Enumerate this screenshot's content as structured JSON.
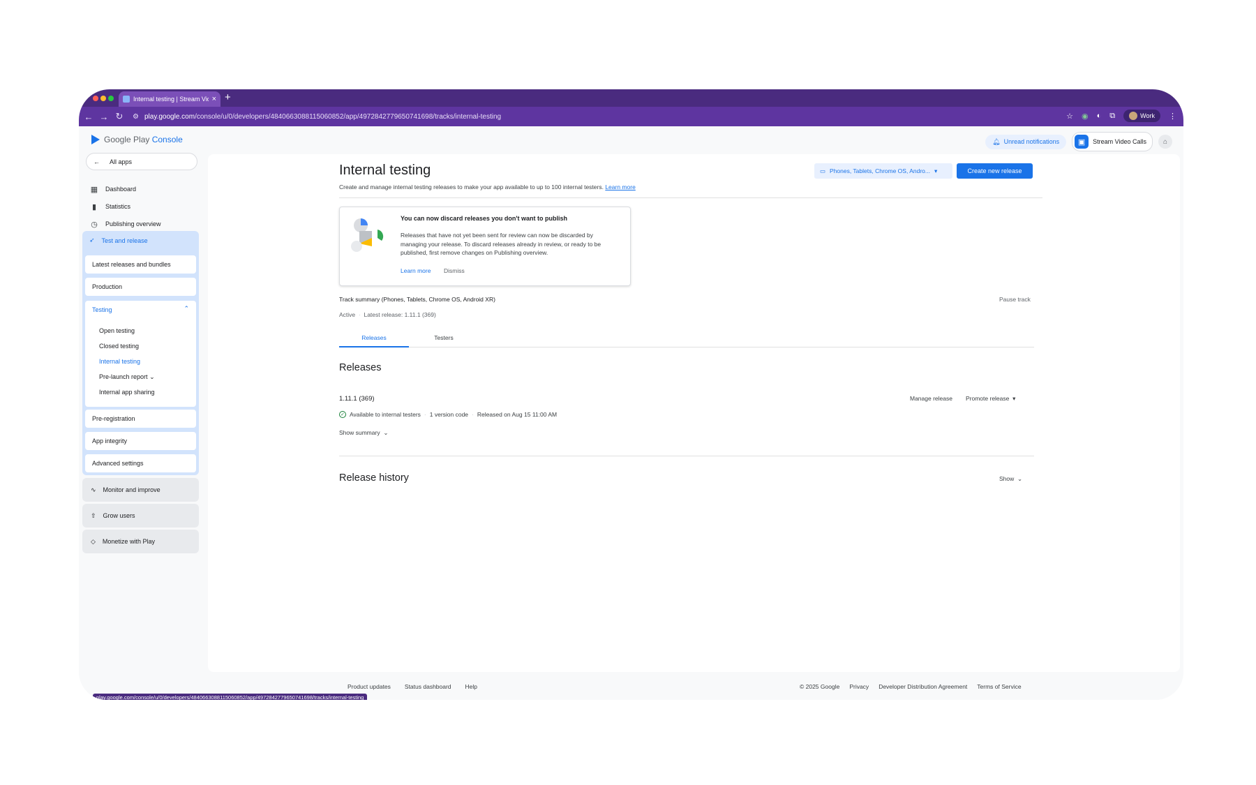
{
  "browser": {
    "tab_title": "Internal testing | Stream Vide…",
    "url_host": "play.google.com",
    "url_path": "/console/u/0/developers/4840663088115060852/app/4972842779650741698/tracks/internal-testing",
    "profile_label": "Work",
    "status_bar_url": "play.google.com/console/u/0/developers/4840663088115060852/app/4972842779650741698/tracks/internal-testing",
    "colors": {
      "tabbar": "#4a2b7f",
      "toolbar": "#5e35a0"
    }
  },
  "header": {
    "logo_text": "Google Play",
    "logo_console": "Console",
    "notifications_label": "Unread notifications",
    "app_name": "Stream Video Calls"
  },
  "sidebar": {
    "all_apps": "All apps",
    "top_items": [
      {
        "label": "Dashboard",
        "icon": "dashboard-icon"
      },
      {
        "label": "Statistics",
        "icon": "bar-chart-icon"
      },
      {
        "label": "Publishing overview",
        "icon": "publishing-icon"
      }
    ],
    "test_release": {
      "label": "Test and release",
      "items": [
        "Latest releases and bundles",
        "Production"
      ],
      "testing": {
        "label": "Testing",
        "subitems": [
          "Open testing",
          "Closed testing",
          "Internal testing",
          "Pre-launch report",
          "Internal app sharing"
        ]
      },
      "items_after": [
        "Pre-registration",
        "App integrity",
        "Advanced settings"
      ]
    },
    "groups": [
      {
        "label": "Monitor and improve",
        "icon": "monitor-icon"
      },
      {
        "label": "Grow users",
        "icon": "grow-icon"
      },
      {
        "label": "Monetize with Play",
        "icon": "tag-icon"
      }
    ]
  },
  "main": {
    "title": "Internal testing",
    "subtitle": "Create and manage internal testing releases to make your app available to up to 100 internal testers.",
    "subtitle_link": "Learn more",
    "device_selector": "Phones, Tablets, Chrome OS, Andro...",
    "create_button": "Create new release",
    "info_card": {
      "title": "You can now discard releases you don't want to publish",
      "body": "Releases that have not yet been sent for review can now be discarded by managing your release. To discard releases already in review, or ready to be published, first remove changes on Publishing overview.",
      "learn_more": "Learn more",
      "dismiss": "Dismiss"
    },
    "track_summary": {
      "title": "Track summary (Phones, Tablets, Chrome OS, Android XR)",
      "pause": "Pause track",
      "status": "Active",
      "latest": "Latest release: 1.11.1 (369)"
    },
    "tabs": [
      "Releases",
      "Testers"
    ],
    "releases_heading": "Releases",
    "release": {
      "version": "1.11.1 (369)",
      "manage": "Manage release",
      "promote": "Promote release",
      "availability": "Available to internal testers",
      "version_codes": "1 version code",
      "released_on": "Released on Aug 15 11:00 AM",
      "show_summary": "Show summary"
    },
    "history_heading": "Release history",
    "history_show": "Show"
  },
  "footer": {
    "left": [
      "Product updates",
      "Status dashboard",
      "Help"
    ],
    "right": [
      "© 2025 Google",
      "Privacy",
      "Developer Distribution Agreement",
      "Terms of Service"
    ]
  }
}
